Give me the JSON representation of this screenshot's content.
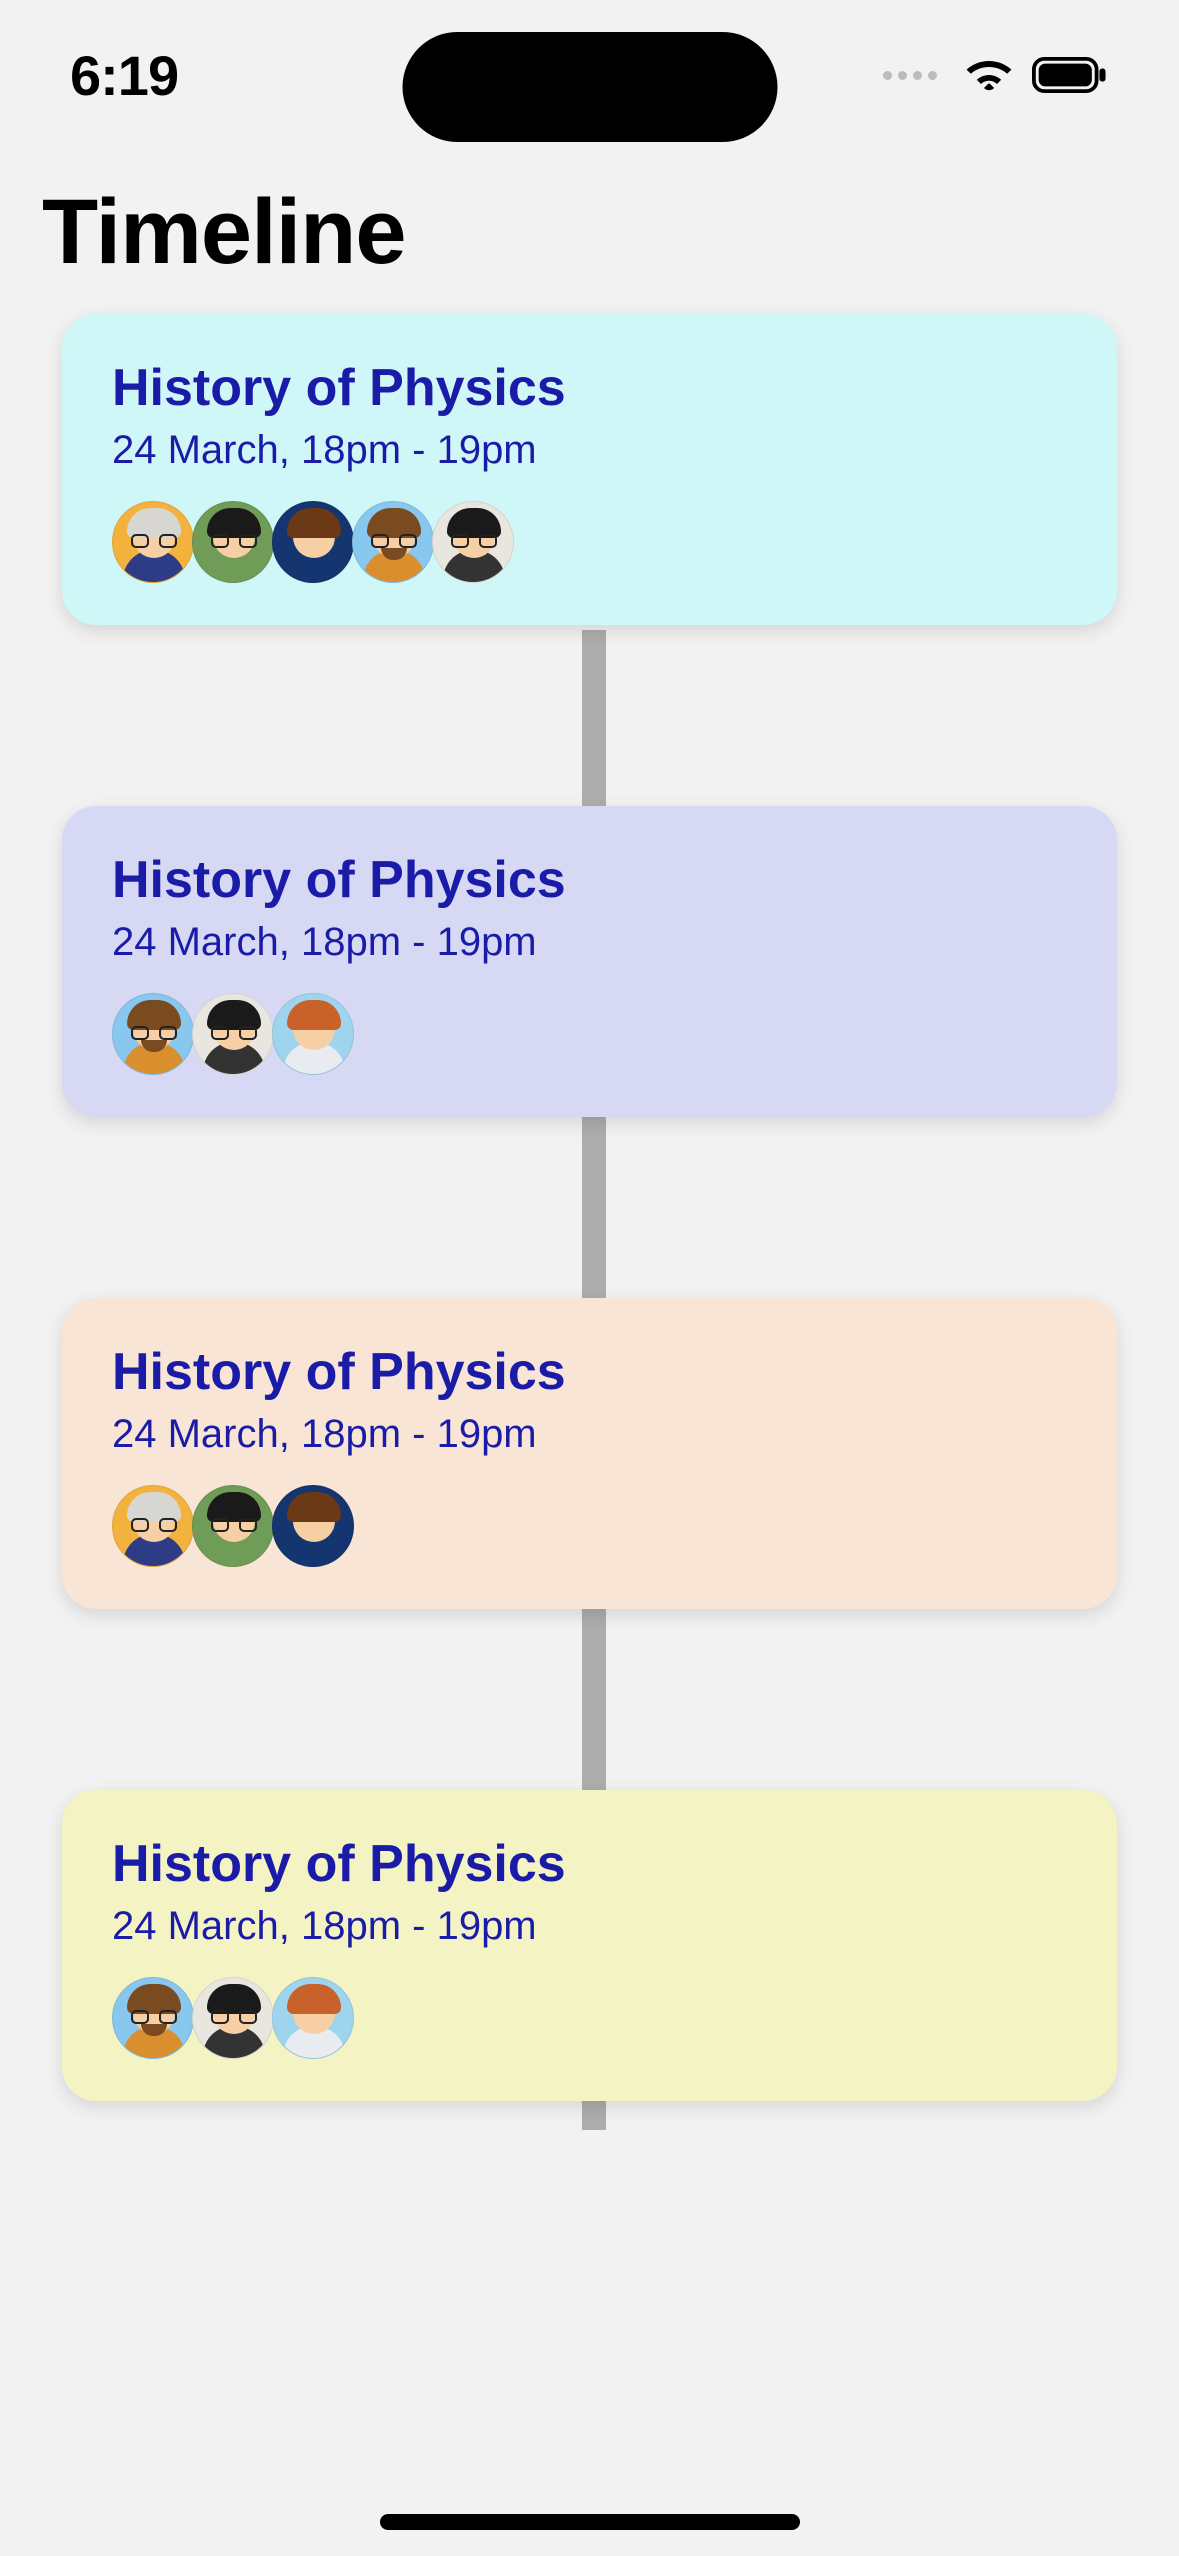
{
  "status_bar": {
    "time": "6:19"
  },
  "page_title": "Timeline",
  "title_color": "#1a1ca8",
  "cards": [
    {
      "title": "History of Physics",
      "subtitle": "24 March, 18pm - 19pm",
      "bg": "#d0f7f7",
      "avatars": [
        {
          "name": "avatar-1",
          "bg": "#f2b23d",
          "hair": "#d8d6d2",
          "body": "#2d3c84",
          "glasses": true,
          "beard": false
        },
        {
          "name": "avatar-2",
          "bg": "#6f9c56",
          "hair": "#1a1a1a",
          "body": "#6f9c56",
          "glasses": true,
          "beard": false
        },
        {
          "name": "avatar-3",
          "bg": "#14356f",
          "hair": "#6b3916",
          "body": "#14356f",
          "glasses": false,
          "beard": false
        },
        {
          "name": "avatar-4",
          "bg": "#88c7ee",
          "hair": "#7a4a20",
          "body": "#d98f2e",
          "glasses": true,
          "beard": true
        },
        {
          "name": "avatar-5",
          "bg": "#e9e6df",
          "hair": "#1a1a1a",
          "body": "#333333",
          "glasses": true,
          "beard": false
        }
      ]
    },
    {
      "title": "History of Physics",
      "subtitle": "24 March, 18pm - 19pm",
      "bg": "#d7d8f3",
      "avatars": [
        {
          "name": "avatar-4",
          "bg": "#88c7ee",
          "hair": "#7a4a20",
          "body": "#d98f2e",
          "glasses": true,
          "beard": true
        },
        {
          "name": "avatar-5",
          "bg": "#e9e6df",
          "hair": "#1a1a1a",
          "body": "#333333",
          "glasses": true,
          "beard": false
        },
        {
          "name": "avatar-6",
          "bg": "#9fd4ee",
          "hair": "#c9622a",
          "body": "#e8ebf0",
          "glasses": false,
          "beard": false
        }
      ]
    },
    {
      "title": "History of Physics",
      "subtitle": "24 March, 18pm - 19pm",
      "bg": "#f8e5d6",
      "avatars": [
        {
          "name": "avatar-1",
          "bg": "#f2b23d",
          "hair": "#d8d6d2",
          "body": "#2d3c84",
          "glasses": true,
          "beard": false
        },
        {
          "name": "avatar-2",
          "bg": "#6f9c56",
          "hair": "#1a1a1a",
          "body": "#6f9c56",
          "glasses": true,
          "beard": false
        },
        {
          "name": "avatar-3",
          "bg": "#14356f",
          "hair": "#6b3916",
          "body": "#14356f",
          "glasses": false,
          "beard": false
        }
      ]
    },
    {
      "title": "History of Physics",
      "subtitle": "24 March, 18pm - 19pm",
      "bg": "#f3f3c4",
      "avatars": [
        {
          "name": "avatar-4",
          "bg": "#88c7ee",
          "hair": "#7a4a20",
          "body": "#d98f2e",
          "glasses": true,
          "beard": true
        },
        {
          "name": "avatar-5",
          "bg": "#e9e6df",
          "hair": "#1a1a1a",
          "body": "#333333",
          "glasses": true,
          "beard": false
        },
        {
          "name": "avatar-6",
          "bg": "#9fd4ee",
          "hair": "#c9622a",
          "body": "#e8ebf0",
          "glasses": false,
          "beard": false
        }
      ]
    }
  ]
}
